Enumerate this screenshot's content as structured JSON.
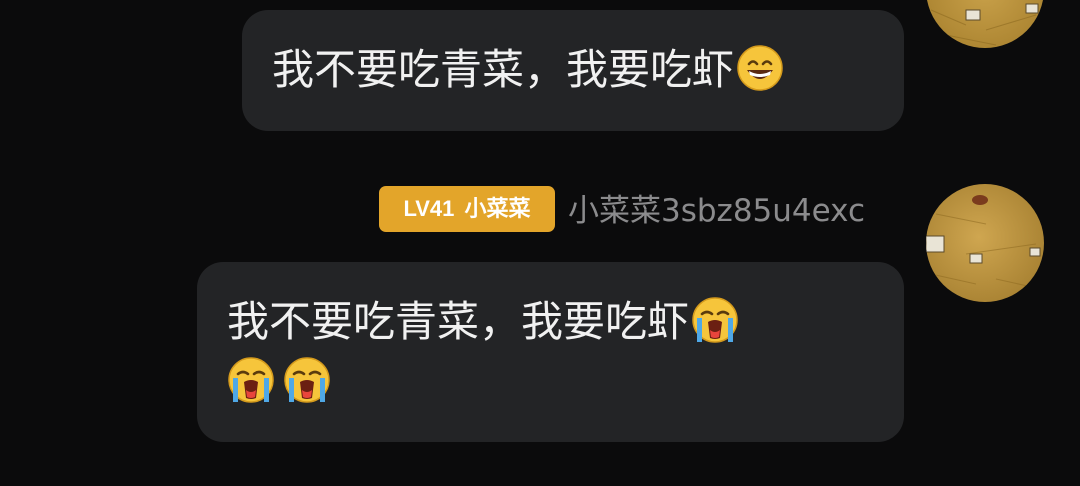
{
  "messages": [
    {
      "text": "我不要吃青菜，我要吃虾",
      "emojis": [
        "grinning-face"
      ]
    },
    {
      "text": "我不要吃青菜，我要吃虾",
      "emojis": [
        "loudly-crying-face",
        "loudly-crying-face",
        "loudly-crying-face"
      ]
    }
  ],
  "sender": {
    "level": "LV41",
    "title": "小菜菜",
    "name": "小菜菜3sbz85u4exc"
  },
  "colors": {
    "background": "#0b0b0c",
    "bubble": "#232426",
    "badge": "#e3a52a",
    "username": "#8b8b8d"
  }
}
